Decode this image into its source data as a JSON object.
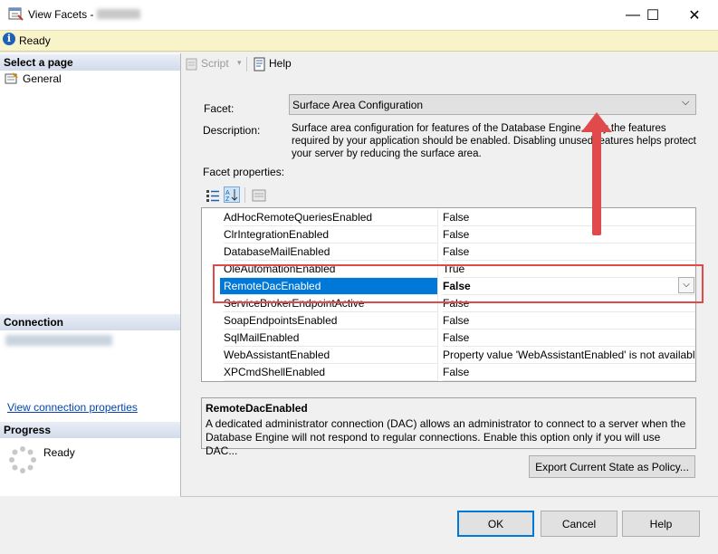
{
  "window": {
    "title": "View Facets -",
    "minimize": "—",
    "maximize": "☐",
    "close": "✕"
  },
  "status": {
    "text": "Ready"
  },
  "left": {
    "select_page": "Select a page",
    "pages": [
      {
        "label": "General"
      }
    ],
    "connection": "Connection",
    "view_connection": "View connection properties",
    "progress": "Progress",
    "progress_status": "Ready"
  },
  "toolbar": {
    "script": "Script",
    "help": "Help"
  },
  "facet": {
    "label": "Facet:",
    "value": "Surface Area Configuration"
  },
  "description": {
    "label": "Description:",
    "text": "Surface area configuration for features of the Database Engine. Only the features required by your application should be enabled. Disabling unused features helps protect your server by reducing the surface area."
  },
  "facet_properties": {
    "label": "Facet properties:",
    "rows": [
      {
        "name": "AdHocRemoteQueriesEnabled",
        "value": "False"
      },
      {
        "name": "ClrIntegrationEnabled",
        "value": "False"
      },
      {
        "name": "DatabaseMailEnabled",
        "value": "False"
      },
      {
        "name": "OleAutomationEnabled",
        "value": "True"
      },
      {
        "name": "RemoteDacEnabled",
        "value": "False"
      },
      {
        "name": "ServiceBrokerEndpointActive",
        "value": "False"
      },
      {
        "name": "SoapEndpointsEnabled",
        "value": "False"
      },
      {
        "name": "SqlMailEnabled",
        "value": "False"
      },
      {
        "name": "WebAssistantEnabled",
        "value": "Property value 'WebAssistantEnabled' is not available"
      },
      {
        "name": "XPCmdShellEnabled",
        "value": "False"
      }
    ]
  },
  "info": {
    "title": "RemoteDacEnabled",
    "text": "A dedicated administrator connection (DAC) allows an administrator to connect to a server when the Database Engine will not respond to regular connections. Enable this option only if you will use DAC..."
  },
  "buttons": {
    "export": "Export Current State as Policy...",
    "ok": "OK",
    "cancel": "Cancel",
    "help": "Help"
  },
  "colors": {
    "selection": "#0078d7",
    "annotation": "#e04a4a",
    "status_bg": "#f8f3c9"
  }
}
